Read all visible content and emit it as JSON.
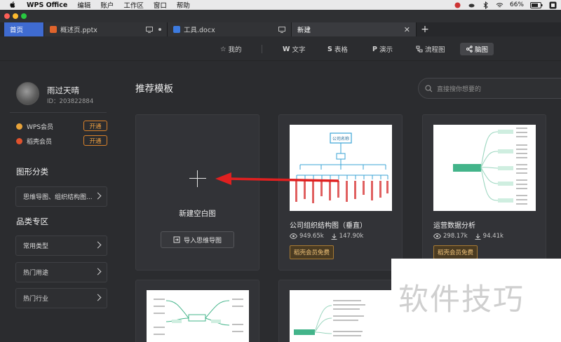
{
  "menubar": {
    "items": [
      "WPS Office",
      "编辑",
      "账户",
      "工作区",
      "窗口",
      "帮助"
    ],
    "battery": "66%"
  },
  "tabs": [
    {
      "label": "首页"
    },
    {
      "label": "概述页.pptx"
    },
    {
      "label": "工具.docx"
    },
    {
      "label": "新建"
    }
  ],
  "typebar": {
    "items": [
      "我的",
      "文字",
      "表格",
      "演示",
      "流程图",
      "脑图"
    ],
    "active": "脑图"
  },
  "user": {
    "name": "雨过天晴",
    "id": "ID：203822884"
  },
  "memberships": [
    {
      "label": "WPS会员",
      "button": "开通",
      "color": "#e8a33a"
    },
    {
      "label": "稻壳会员",
      "button": "开通",
      "color": "#e0522d"
    }
  ],
  "sidebar": {
    "graphic_heading": "图形分类",
    "graphic_item": "思维导图、组织结构图...",
    "category_heading": "品类专区",
    "category_items": [
      "常用类型",
      "热门用途",
      "热门行业"
    ]
  },
  "main": {
    "title": "推荐模板",
    "search_placeholder": "直接搜你想要的",
    "blank_label": "新建空白图",
    "import_label": "导入思维导图"
  },
  "templates": [
    {
      "title": "公司组织结构图（垂直）",
      "views": "949.65k",
      "downloads": "147.90k",
      "badge": "稻壳会员免费",
      "thumb_title": "公司名称"
    },
    {
      "title": "运营数据分析",
      "views": "298.17k",
      "downloads": "94.41k",
      "badge": "稻壳会员免费"
    }
  ],
  "watermark": "软件技巧",
  "colors": {
    "accent": "#3f6bd0",
    "annotation_arrow": "#e02020",
    "open_button": "#d9822b"
  }
}
